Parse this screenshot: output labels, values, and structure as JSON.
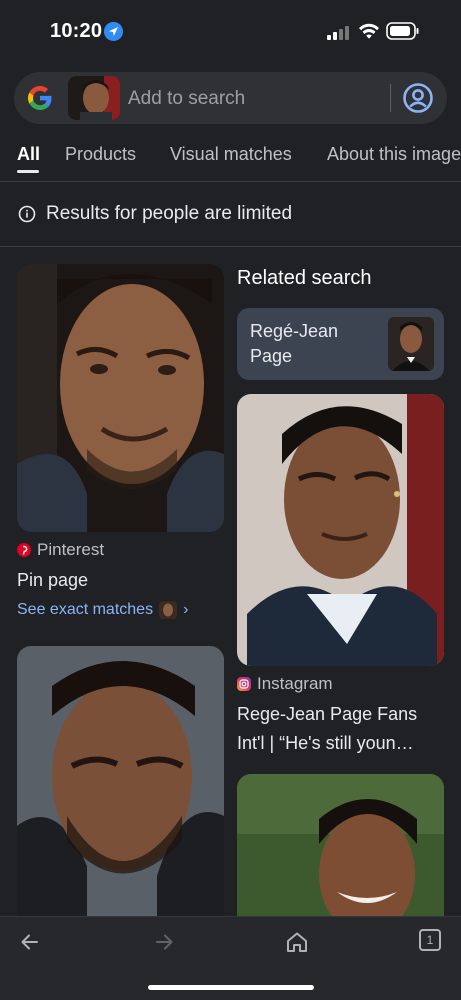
{
  "status": {
    "time": "10:20"
  },
  "search": {
    "placeholder": "Add to search",
    "value": ""
  },
  "tabs": [
    {
      "label": "All",
      "active": true
    },
    {
      "label": "Products",
      "active": false
    },
    {
      "label": "Visual matches",
      "active": false
    },
    {
      "label": "About this image",
      "active": false
    }
  ],
  "notice": {
    "text": "Results for people are limited"
  },
  "results_left": [
    {
      "source": "Pinterest",
      "title": "Pin page",
      "exact_link": "See exact matches",
      "chevron": "›"
    },
    {
      "source": "",
      "title": ""
    }
  ],
  "related": {
    "heading": "Related search",
    "chip_label": "Regé-Jean Page"
  },
  "results_right": [
    {
      "source": "Instagram",
      "title": "Rege-Jean Page Fans Int'l | “He's still youn…"
    },
    {
      "source": "",
      "title": ""
    }
  ],
  "toolbar": {
    "tab_count": "1"
  },
  "colors": {
    "background": "#202124",
    "link": "#8ab4f8",
    "pinterest": "#e60023",
    "chip": "#3c4452"
  },
  "icons": [
    "location-arrow-icon",
    "signal-icon",
    "wifi-icon",
    "battery-icon",
    "google-logo",
    "account-icon",
    "info-icon",
    "pinterest-icon",
    "instagram-icon",
    "back-icon",
    "forward-icon",
    "home-icon",
    "tabs-icon"
  ]
}
